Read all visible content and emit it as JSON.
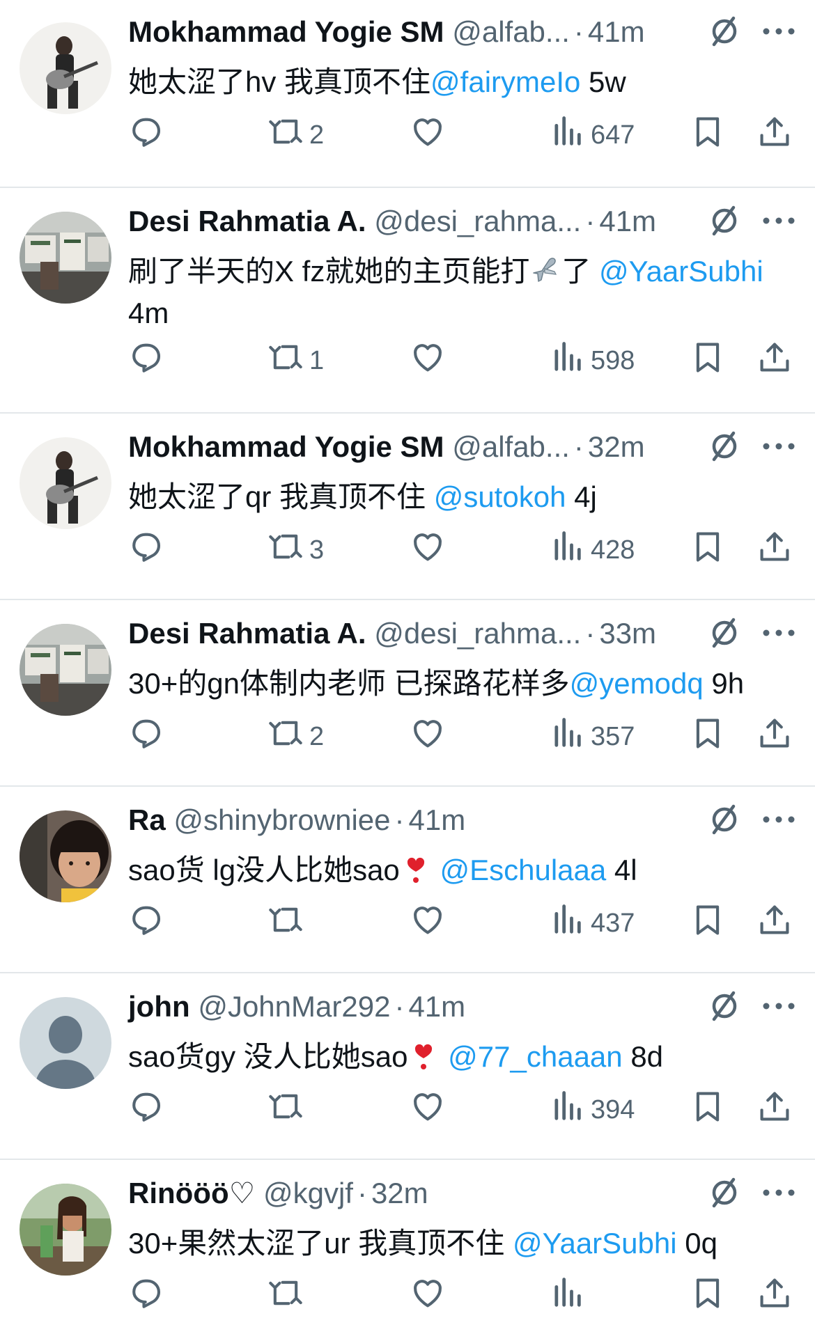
{
  "tweets": [
    {
      "name": "Mokhammad Yogie SM",
      "handle": "@alfab...",
      "separator": "·",
      "time": "41m",
      "avatar": "guitar-player-photo",
      "text_parts": [
        {
          "text": "她太涩了hv 我真顶不住",
          "kind": "text"
        },
        {
          "text": "@fairymeIo",
          "kind": "mention"
        },
        {
          "text": " 5w",
          "kind": "text"
        }
      ],
      "retweets": "2",
      "likes": "",
      "views": "647"
    },
    {
      "name": "Desi Rahmatia A.",
      "handle": "@desi_rahma...",
      "separator": "·",
      "time": "41m",
      "avatar": "office-room-photo",
      "text_parts": [
        {
          "text": "刷了半天的X fz就她的主页能打",
          "kind": "text"
        },
        {
          "text": "airplane",
          "kind": "emoji"
        },
        {
          "text": "了 ",
          "kind": "text"
        },
        {
          "text": "@YaarSubhi",
          "kind": "mention"
        },
        {
          "text": " 4m",
          "kind": "text"
        }
      ],
      "retweets": "1",
      "likes": "",
      "views": "598"
    },
    {
      "name": "Mokhammad Yogie SM",
      "handle": "@alfab...",
      "separator": "·",
      "time": "32m",
      "avatar": "guitar-player-photo",
      "text_parts": [
        {
          "text": "她太涩了qr 我真顶不住 ",
          "kind": "text"
        },
        {
          "text": "@sutokoh",
          "kind": "mention"
        },
        {
          "text": " 4j",
          "kind": "text"
        }
      ],
      "retweets": "3",
      "likes": "",
      "views": "428"
    },
    {
      "name": "Desi Rahmatia A.",
      "handle": "@desi_rahma...",
      "separator": "·",
      "time": "33m",
      "avatar": "office-room-photo",
      "text_parts": [
        {
          "text": "30+的gn体制内老师 已探路花样多",
          "kind": "text"
        },
        {
          "text": "@yemodq",
          "kind": "mention"
        },
        {
          "text": " 9h",
          "kind": "text"
        }
      ],
      "retweets": "2",
      "likes": "",
      "views": "357"
    },
    {
      "name": "Ra",
      "handle": "@shinybrowniee",
      "separator": "·",
      "time": "41m",
      "avatar": "child-photo",
      "text_parts": [
        {
          "text": "sao货 lg没人比她sao",
          "kind": "text"
        },
        {
          "text": "heart-exclamation",
          "kind": "emoji"
        },
        {
          "text": " ",
          "kind": "text"
        },
        {
          "text": "@Eschulaaa",
          "kind": "mention"
        },
        {
          "text": " 4l",
          "kind": "text"
        }
      ],
      "retweets": "",
      "likes": "",
      "views": "437"
    },
    {
      "name": "john",
      "handle": "@JohnMar292",
      "separator": "·",
      "time": "41m",
      "avatar": "default-profile-silhouette",
      "text_parts": [
        {
          "text": "sao货gy 没人比她sao",
          "kind": "text"
        },
        {
          "text": "heart-exclamation",
          "kind": "emoji"
        },
        {
          "text": " ",
          "kind": "text"
        },
        {
          "text": "@77_chaaan",
          "kind": "mention"
        },
        {
          "text": " 8d",
          "kind": "text"
        }
      ],
      "retweets": "",
      "likes": "",
      "views": "394"
    },
    {
      "name": "Rinööö♡",
      "handle": "@kgvjf",
      "separator": "·",
      "time": "32m",
      "avatar": "woman-outdoor-photo",
      "text_parts": [
        {
          "text": "30+果然太涩了ur 我真顶不住 ",
          "kind": "text"
        },
        {
          "text": "@YaarSubhi",
          "kind": "mention"
        },
        {
          "text": " 0q",
          "kind": "text"
        }
      ],
      "retweets": "",
      "likes": "",
      "views": ""
    }
  ],
  "icons": {
    "grok": "grok-slash-icon",
    "more": "more-dots-icon",
    "reply": "reply-bubble-icon",
    "retweet": "retweet-arrows-icon",
    "like": "heart-icon",
    "views": "views-bar-chart-icon",
    "bookmark": "bookmark-icon",
    "share": "share-upload-icon"
  },
  "colors": {
    "text": "#0f1419",
    "muted": "#536471",
    "link": "#1d9bf0",
    "divider": "#e3e7ea"
  }
}
